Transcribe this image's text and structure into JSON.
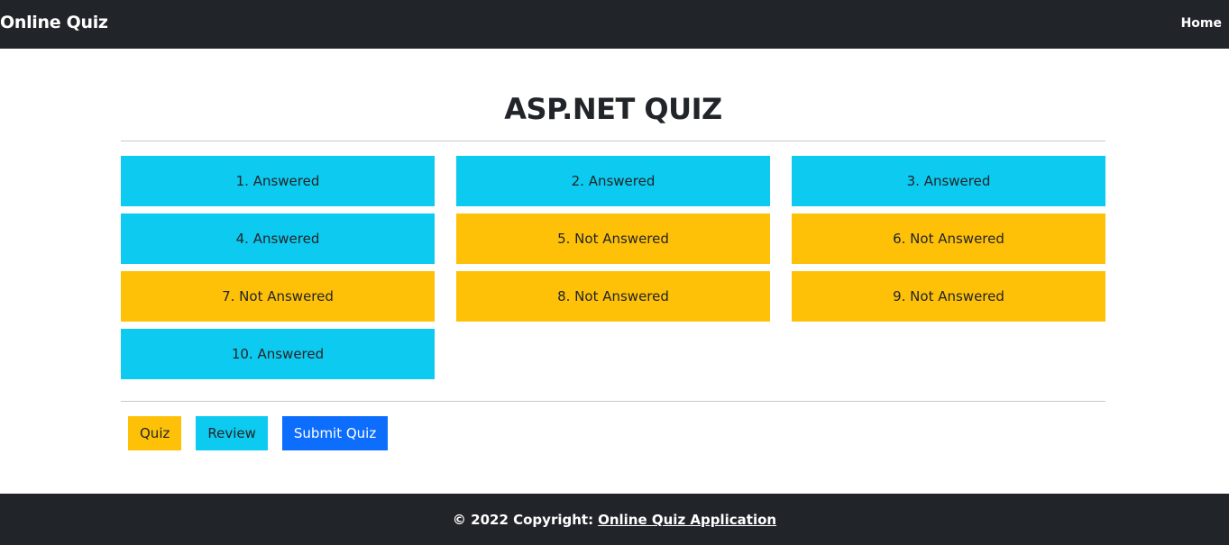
{
  "navbar": {
    "brand": "Online Quiz",
    "home_label": "Home"
  },
  "page": {
    "title": "ASP.NET QUIZ"
  },
  "questions": [
    {
      "label": "1. Answered",
      "status": "answered"
    },
    {
      "label": "2. Answered",
      "status": "answered"
    },
    {
      "label": "3. Answered",
      "status": "answered"
    },
    {
      "label": "4. Answered",
      "status": "answered"
    },
    {
      "label": "5. Not Answered",
      "status": "not-answered"
    },
    {
      "label": "6. Not Answered",
      "status": "not-answered"
    },
    {
      "label": "7. Not Answered",
      "status": "not-answered"
    },
    {
      "label": "8. Not Answered",
      "status": "not-answered"
    },
    {
      "label": "9. Not Answered",
      "status": "not-answered"
    },
    {
      "label": "10. Answered",
      "status": "answered"
    }
  ],
  "actions": {
    "quiz_label": "Quiz",
    "review_label": "Review",
    "submit_label": "Submit Quiz"
  },
  "footer": {
    "copyright": "© 2022 Copyright:",
    "link_label": "Online Quiz Application"
  },
  "colors": {
    "answered": "#0dcaf0",
    "not_answered": "#ffc107",
    "primary": "#0d6efd",
    "dark": "#212529",
    "quiz_button": "#ffc107",
    "review_button": "#0dcaf0"
  }
}
